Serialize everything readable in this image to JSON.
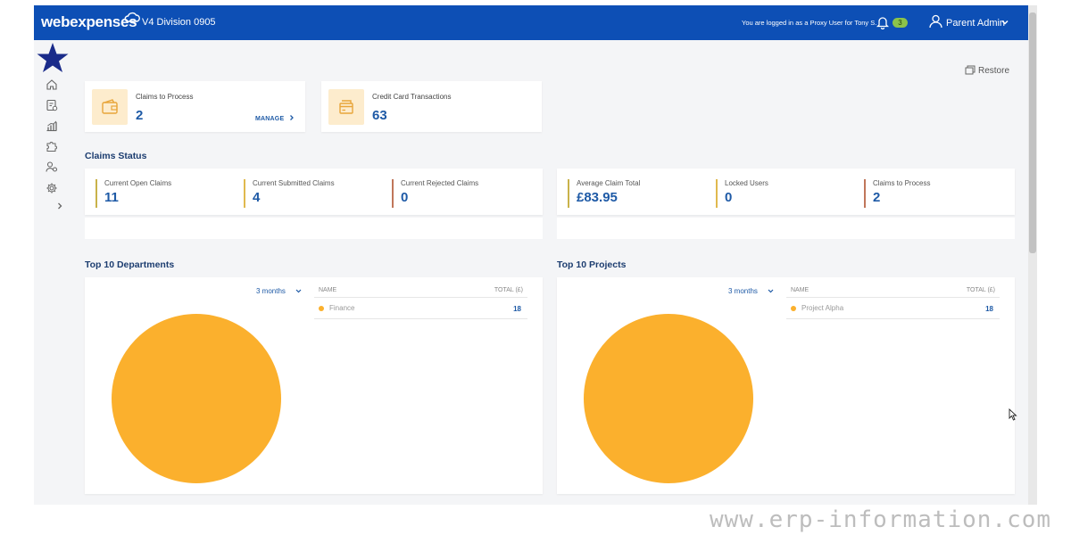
{
  "header": {
    "brand": "webexpenses",
    "division": "V4 Division 0905",
    "proxy_notice": "You are logged in as a Proxy User for Tony S.",
    "notification_count": "3",
    "user_name": "Parent Admin"
  },
  "sidebar": {
    "items": [
      {
        "icon": "home-icon"
      },
      {
        "icon": "claims-icon"
      },
      {
        "icon": "reports-icon"
      },
      {
        "icon": "puzzle-icon"
      },
      {
        "icon": "users-settings-icon"
      },
      {
        "icon": "gear-icon"
      },
      {
        "icon": "chevron-right-icon"
      }
    ]
  },
  "toolbar": {
    "restore_label": "Restore"
  },
  "summary_cards": [
    {
      "title": "Claims to Process",
      "value": "2",
      "action": "MANAGE"
    },
    {
      "title": "Credit Card Transactions",
      "value": "63"
    }
  ],
  "claims_status": {
    "title": "Claims Status",
    "left": [
      {
        "label": "Current Open Claims",
        "value": "11",
        "color": "#c9b24a"
      },
      {
        "label": "Current Submitted Claims",
        "value": "4",
        "color": "#e0b94e"
      },
      {
        "label": "Current Rejected Claims",
        "value": "0",
        "color": "#c0765a"
      }
    ],
    "right": [
      {
        "label": "Average Claim Total",
        "value": "£83.95",
        "color": "#c9b24a"
      },
      {
        "label": "Locked Users",
        "value": "0",
        "color": "#e0b94e"
      },
      {
        "label": "Claims to Process",
        "value": "2",
        "color": "#c0765a"
      }
    ]
  },
  "departments": {
    "title": "Top 10 Departments",
    "range": "3 months",
    "columns": {
      "name": "NAME",
      "total": "TOTAL (£)"
    },
    "rows": [
      {
        "name": "Finance",
        "total": "18"
      }
    ]
  },
  "projects": {
    "title": "Top 10 Projects",
    "range": "3 months",
    "columns": {
      "name": "NAME",
      "total": "TOTAL (£)"
    },
    "rows": [
      {
        "name": "Project Alpha",
        "total": "18"
      }
    ]
  },
  "chart_data": [
    {
      "type": "pie",
      "categories": [
        "Finance"
      ],
      "values": [
        18
      ],
      "colors": [
        "#fbb02d"
      ]
    },
    {
      "type": "pie",
      "categories": [
        "Project Alpha"
      ],
      "values": [
        18
      ],
      "colors": [
        "#fbb02d"
      ]
    }
  ],
  "colors": {
    "header_bg": "#0d4fb5",
    "accent_blue": "#1e5aa6",
    "pie_orange": "#fbb02d",
    "star_navy": "#1a2b8a"
  },
  "watermark": "www.erp-information.com"
}
